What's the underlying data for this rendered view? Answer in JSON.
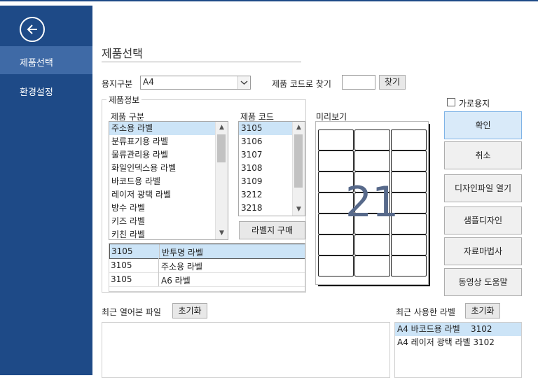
{
  "sidebar": {
    "items": [
      {
        "label": "제품선택",
        "active": true
      },
      {
        "label": "환경설정",
        "active": false
      }
    ]
  },
  "page": {
    "title": "제품선택"
  },
  "paper": {
    "label": "용지구분",
    "value": "A4"
  },
  "code_search": {
    "label": "제품 코드로 찾기",
    "value": "",
    "button": "찾기"
  },
  "product_info": {
    "legend": "제품정보",
    "category_header": "제품 구분",
    "categories": [
      "주소용 라벨",
      "분류표기용 라벨",
      "물류관리용 라벨",
      "화일인덱스용 라벨",
      "바코드용 라벨",
      "레이저 광택 라벨",
      "방수 라벨",
      "키즈 라벨",
      "키친 라벨"
    ],
    "category_selected": 0,
    "code_header": "제품 코드",
    "codes": [
      "3105",
      "3106",
      "3107",
      "3108",
      "3109",
      "3212",
      "3218"
    ],
    "code_selected": 0,
    "buy_button": "라벨지 구매",
    "preview_header": "미리보기",
    "preview_count": "21",
    "matches": [
      {
        "code": "3105",
        "name": "반투명 라벨",
        "selected": true
      },
      {
        "code": "3105",
        "name": "주소용 라벨",
        "selected": false
      },
      {
        "code": "3105",
        "name": "A6 라벨",
        "selected": false
      }
    ]
  },
  "landscape": {
    "label": "가로용지",
    "checked": false
  },
  "actions": {
    "confirm": "확인",
    "cancel": "취소",
    "open_design": "디자인파일 열기",
    "sample_design": "샘플디자인",
    "data_wizard": "자료마법사",
    "video_help": "동영상 도움말"
  },
  "recent_files": {
    "label": "최근 열어본 파일",
    "reset": "초기화",
    "items": []
  },
  "recent_labels": {
    "label": "최근 사용한 라벨",
    "reset": "초기화",
    "items": [
      "A4 바코드용 라벨    3102",
      "A4 레이저 광택 라벨 3102"
    ]
  }
}
